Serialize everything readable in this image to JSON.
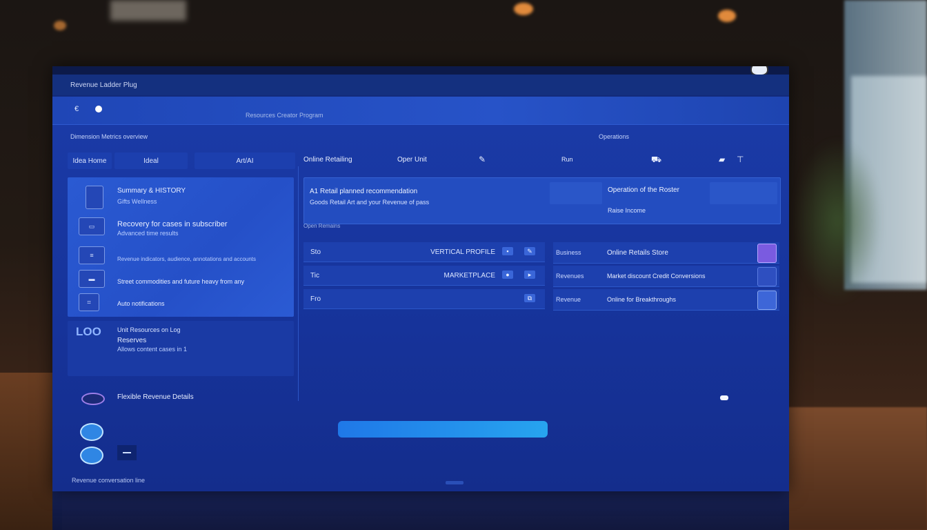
{
  "window": {
    "title": "Revenue Ladder Plug"
  },
  "toolbar": {
    "back_label": "€",
    "center_label": "Resources Creator Program"
  },
  "header": {
    "breadcrumb": "Dimension Metrics overview",
    "right_section": "Operations"
  },
  "tabs": [
    {
      "label": "Idea Home"
    },
    {
      "label": "Ideal"
    },
    {
      "label": "Art/AI"
    }
  ],
  "columns": {
    "col1": "Online Retailing",
    "col2": "Oper Unit",
    "col3": "Run"
  },
  "left_panel": {
    "items": [
      {
        "icon": "",
        "title": "Summary & HISTORY",
        "sub": "Gifts  Wellness"
      },
      {
        "icon": "",
        "title": "Recovery for cases in subscriber",
        "sub": "Advanced time results"
      },
      {
        "icon": "",
        "title": "",
        "sub": "Revenue indicators, audience, annotations and accounts"
      },
      {
        "icon": "",
        "title": "Street commodities and future heavy from any",
        "sub": ""
      },
      {
        "icon": "",
        "title": "Auto notifications",
        "sub": ""
      }
    ]
  },
  "left_lower": {
    "badge": "LOO",
    "line1": "Unit Resources on Log",
    "line2": "Reserves",
    "line3": "Allows content cases in 1"
  },
  "banner": {
    "title": "A1 Retail planned recommendation",
    "sub": "Goods Retail Art and your Revenue of pass",
    "right_title": "Operation of the Roster",
    "right_sub": "Raise Income",
    "tag": "Open Remains"
  },
  "mid_list": [
    {
      "label": "Sto",
      "value": "VERTICAL PROFILE"
    },
    {
      "label": "Tic",
      "value": "MARKETPLACE"
    },
    {
      "label": "Fro",
      "value": ""
    }
  ],
  "right_list": [
    {
      "key": "Business",
      "val": "Online Retails Store",
      "color": "#7a5be0"
    },
    {
      "key": "Revenues",
      "val": "Market discount Credit Conversions",
      "color": "#2e4fc0"
    },
    {
      "key": "Revenue",
      "val": "Online for Breakthroughs",
      "color": "#3d66d8"
    }
  ],
  "footer": {
    "link": "Flexible Revenue Details",
    "status": "Revenue conversation line"
  },
  "colors": {
    "accent": "#27a4ef",
    "panel": "#2550c8",
    "background": "#16339a"
  }
}
